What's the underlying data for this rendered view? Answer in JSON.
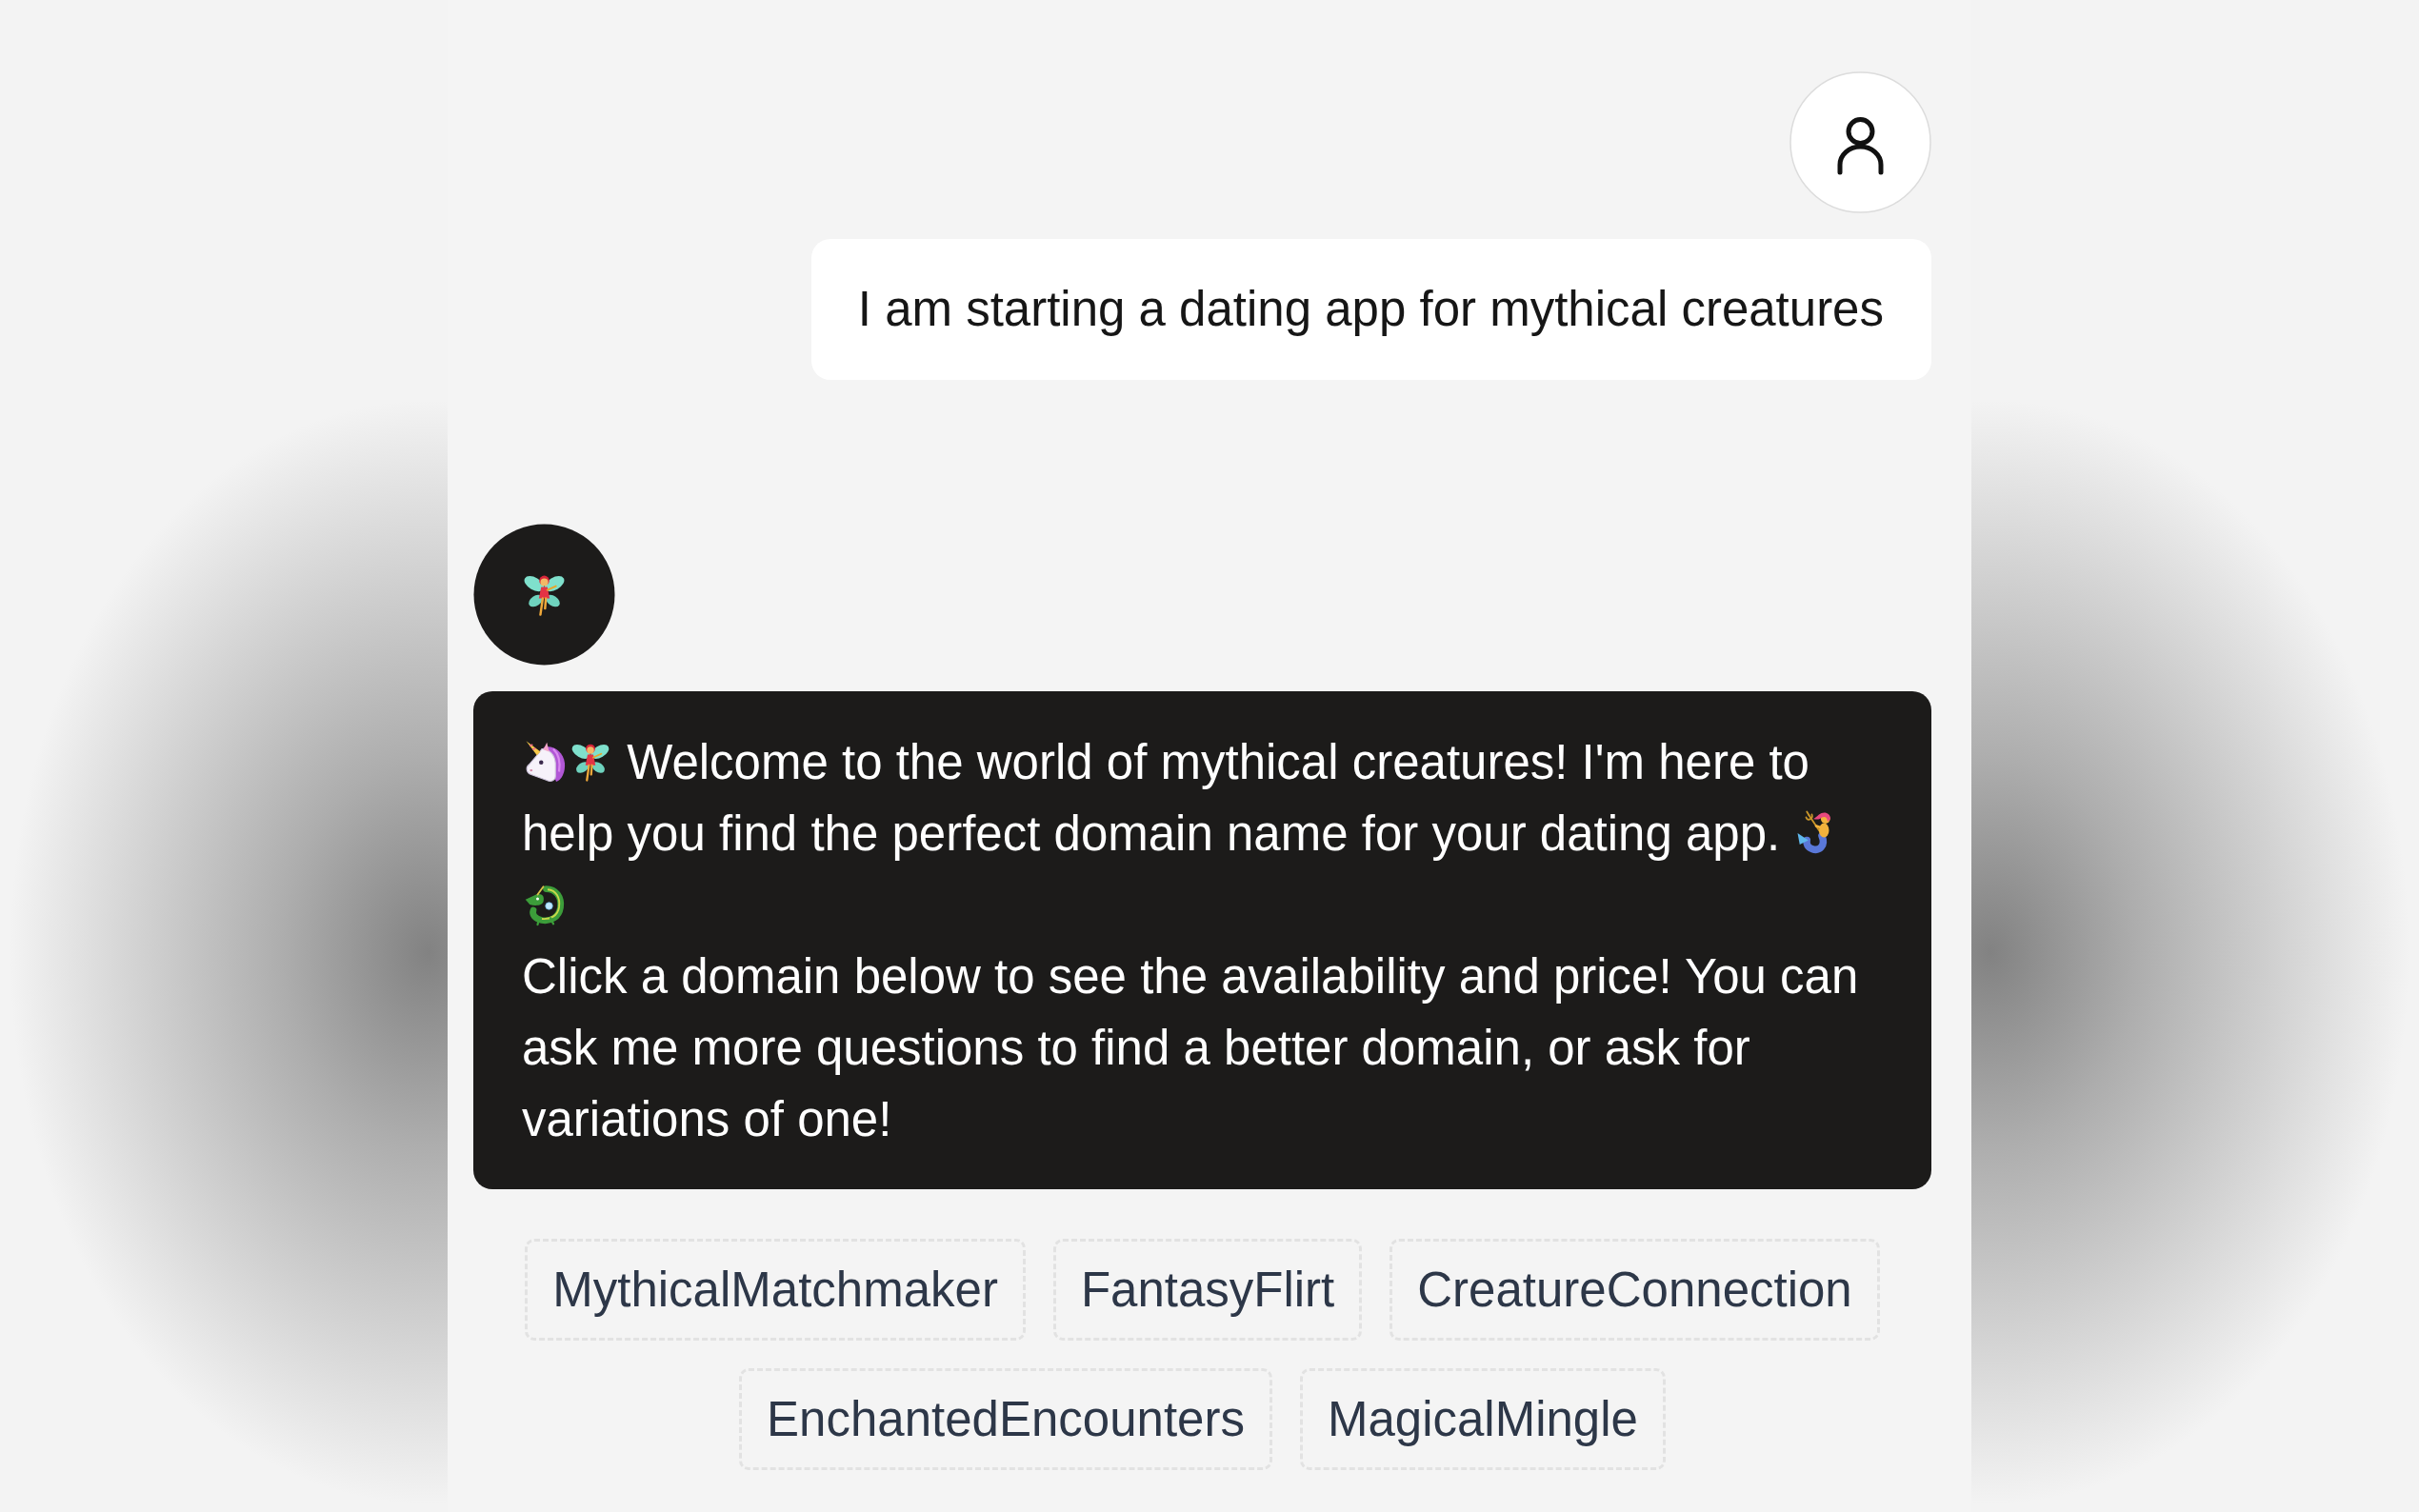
{
  "user_message": {
    "text": "I am starting a dating app for mythical creatures"
  },
  "assistant_message": {
    "greeting_lines": [
      "Welcome to the world of mythical creatures! I'm here to",
      "help you find the perfect domain name for your dating app."
    ],
    "instructions": "Click a domain below to see the availability and price! You can ask me more questions to find a better domain, or ask for variations of one!"
  },
  "domain_suggestions": [
    "MythicalMatchmaker",
    "FantasyFlirt",
    "CreatureConnection",
    "EnchantedEncounters",
    "MagicalMingle"
  ]
}
